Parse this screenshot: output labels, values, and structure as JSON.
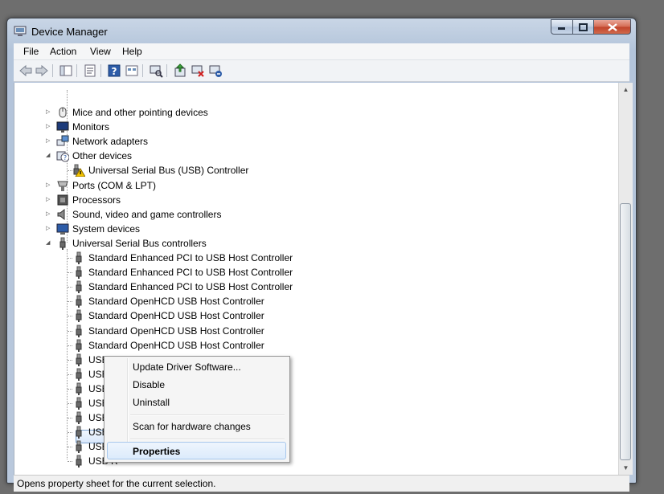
{
  "window": {
    "title": "Device Manager"
  },
  "menubar": {
    "items": [
      "File",
      "Action",
      "View",
      "Help"
    ]
  },
  "toolbar": {
    "buttons": [
      "back-arrow-icon",
      "forward-arrow-icon",
      "show-hide-console-tree-icon",
      "properties-icon",
      "help-icon",
      "view-icon",
      "scan-hardware-icon",
      "update-driver-icon",
      "disable-device-icon",
      "uninstall-device-icon"
    ]
  },
  "tree": {
    "rows": [
      {
        "label": "Mice and other pointing devices",
        "expander": "collapsed"
      },
      {
        "label": "Monitors",
        "expander": "collapsed"
      },
      {
        "label": "Network adapters",
        "expander": "collapsed"
      },
      {
        "label": "Other devices",
        "expander": "expanded"
      },
      {
        "label": "Universal Serial Bus (USB) Controller",
        "expander": "none"
      },
      {
        "label": "Ports (COM & LPT)",
        "expander": "collapsed"
      },
      {
        "label": "Processors",
        "expander": "collapsed"
      },
      {
        "label": "Sound, video and game controllers",
        "expander": "collapsed"
      },
      {
        "label": "System devices",
        "expander": "collapsed"
      },
      {
        "label": "Universal Serial Bus controllers",
        "expander": "expanded"
      },
      {
        "label": "Standard Enhanced PCI to USB Host Controller"
      },
      {
        "label": "Standard Enhanced PCI to USB Host Controller"
      },
      {
        "label": "Standard Enhanced PCI to USB Host Controller"
      },
      {
        "label": "Standard OpenHCD USB Host Controller"
      },
      {
        "label": "Standard OpenHCD USB Host Controller"
      },
      {
        "label": "Standard OpenHCD USB Host Controller"
      },
      {
        "label": "Standard OpenHCD USB Host Controller"
      },
      {
        "label": "USB Composite Device"
      },
      {
        "label": "USB Root Hub"
      },
      {
        "label": "USB R"
      },
      {
        "label": "USB R"
      },
      {
        "label": "USB R"
      },
      {
        "label": "USB R"
      },
      {
        "label": "USB R"
      },
      {
        "label": "USB R"
      }
    ]
  },
  "context_menu": {
    "items": [
      "Update Driver Software...",
      "Disable",
      "Uninstall",
      "Scan for hardware changes",
      "Properties"
    ]
  },
  "statusbar": {
    "text": "Opens property sheet for the current selection."
  },
  "colors": {
    "selection": "#d9e8fb",
    "menu_highlight": "#dcebfc",
    "close_button": "#c0432a"
  }
}
